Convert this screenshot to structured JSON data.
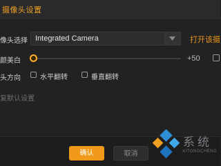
{
  "dialog": {
    "title": "摄像头设置"
  },
  "camera": {
    "label": "像头选择",
    "selected": "Integrated Camera",
    "open_link": "打开该摄"
  },
  "beauty": {
    "label": "颜美白",
    "value_text": "+50",
    "level": 0.0
  },
  "orientation": {
    "label": "头方向",
    "options": [
      {
        "label": "水平翻转",
        "checked": false
      },
      {
        "label": "垂直翻转",
        "checked": false
      }
    ]
  },
  "reset": {
    "label": "复默认设置"
  },
  "footer": {
    "ok_label": "确认",
    "cancel_label": "取消"
  },
  "watermark": {
    "text": "系统",
    "sub": "XITONGCHENG"
  },
  "colors": {
    "accent": "#f0a020",
    "background": "#222223"
  }
}
